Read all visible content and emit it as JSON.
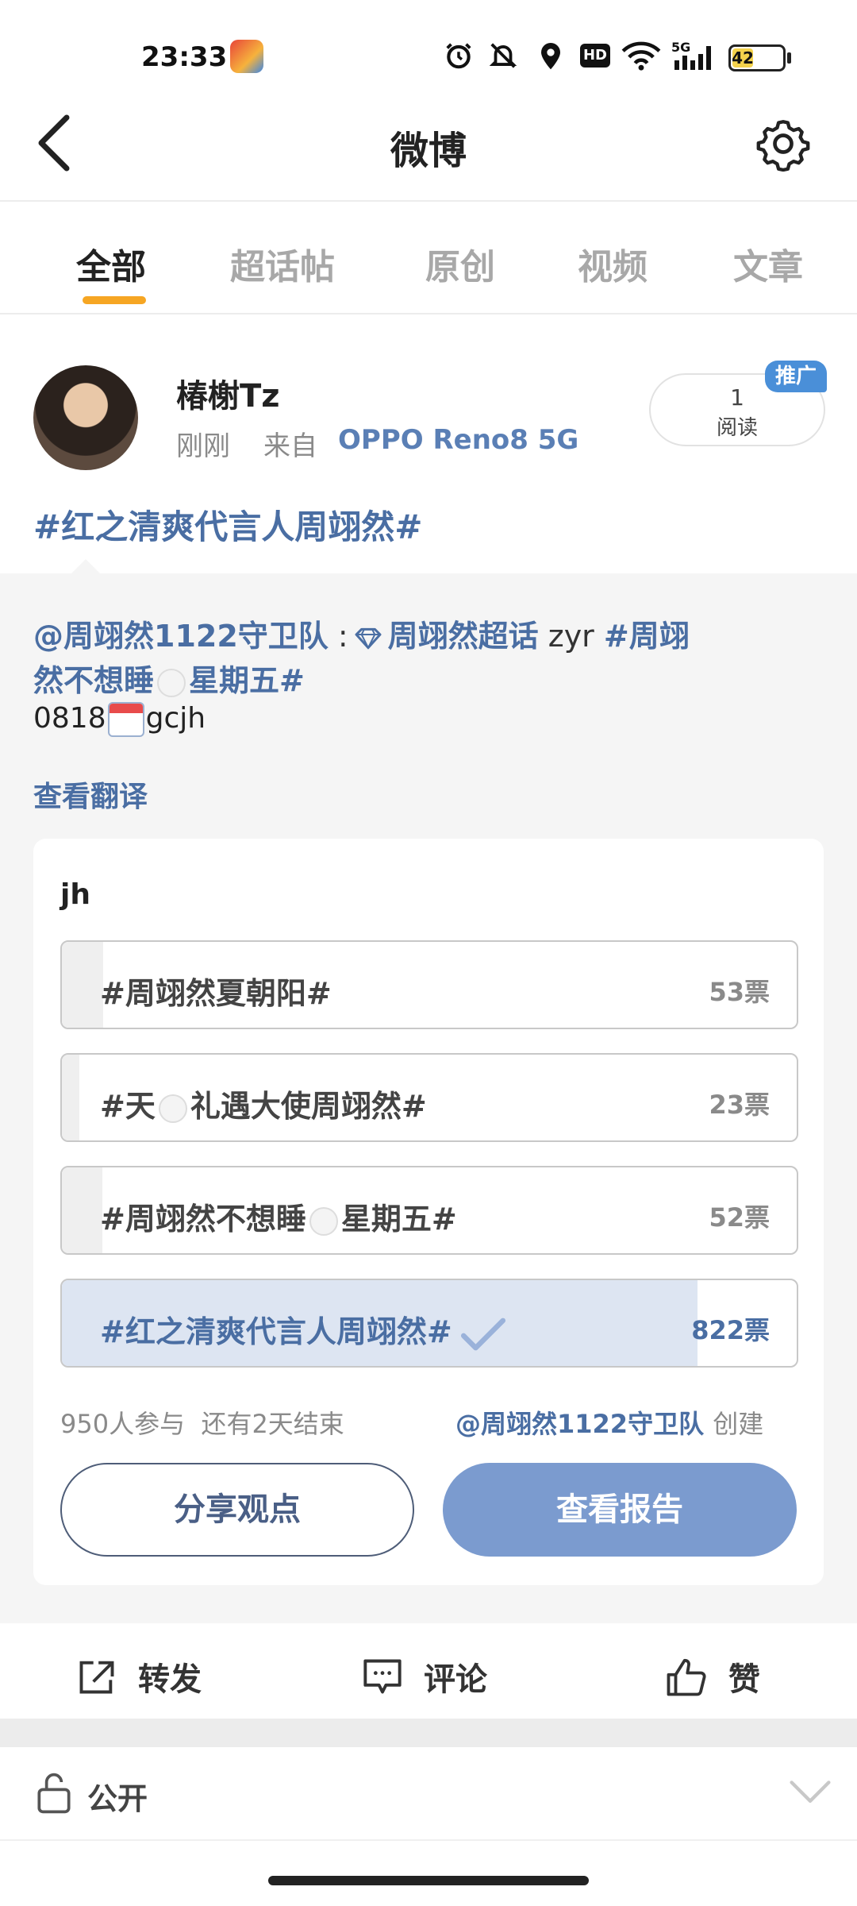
{
  "status_bar": {
    "time": "23:33",
    "network": "5G",
    "hd": "HD",
    "battery": "42"
  },
  "header": {
    "title": "微博"
  },
  "tabs": [
    {
      "label": "全部",
      "active": true
    },
    {
      "label": "超话帖"
    },
    {
      "label": "原创"
    },
    {
      "label": "视频"
    },
    {
      "label": "文章"
    }
  ],
  "post": {
    "username": "椿榭Tz",
    "time": "刚刚",
    "from_label": "来自",
    "device": "OPPO Reno8 5G",
    "read_count": "1",
    "read_label": "阅读",
    "promo_badge": "推广",
    "topic": "#红之清爽代言人周翊然#"
  },
  "repost": {
    "mention": "@周翊然1122守卫队",
    "colon": " :",
    "supertopic": "周翊然超话",
    "text_plain": " zyr ",
    "tag_part1": "#周翊",
    "tag_part2a": "然不想睡",
    "tag_part2b": "星期五#",
    "line3_a": "0818",
    "line3_b": "gcjh",
    "translate": "查看翻译"
  },
  "poll": {
    "title": "jh",
    "options": [
      {
        "label": "#周翊然夏朝阳#",
        "votes": "53票",
        "share": 0.056
      },
      {
        "label_a": "#天",
        "label_b": "礼遇大使周翊然#",
        "votes": "23票",
        "share": 0.024
      },
      {
        "label_a": "#周翊然不想睡",
        "label_b": "星期五#",
        "votes": "52票",
        "share": 0.055
      },
      {
        "label": "#红之清爽代言人周翊然#",
        "votes": "822票",
        "share": 0.865,
        "selected": true
      }
    ],
    "participants": "950人参与",
    "remaining": "还有2天结束",
    "creator": "@周翊然1122守卫队",
    "created_label": "创建",
    "share_button": "分享观点",
    "report_button": "查看报告"
  },
  "actions": {
    "repost": "转发",
    "comment": "评论",
    "like": "赞"
  },
  "visibility": {
    "label": "公开"
  },
  "colors": {
    "accent_underline": "#f6a623",
    "link_blue": "#4a6ea3",
    "report_button": "#7b9bcf",
    "selected_fill": "#dde5f2"
  }
}
